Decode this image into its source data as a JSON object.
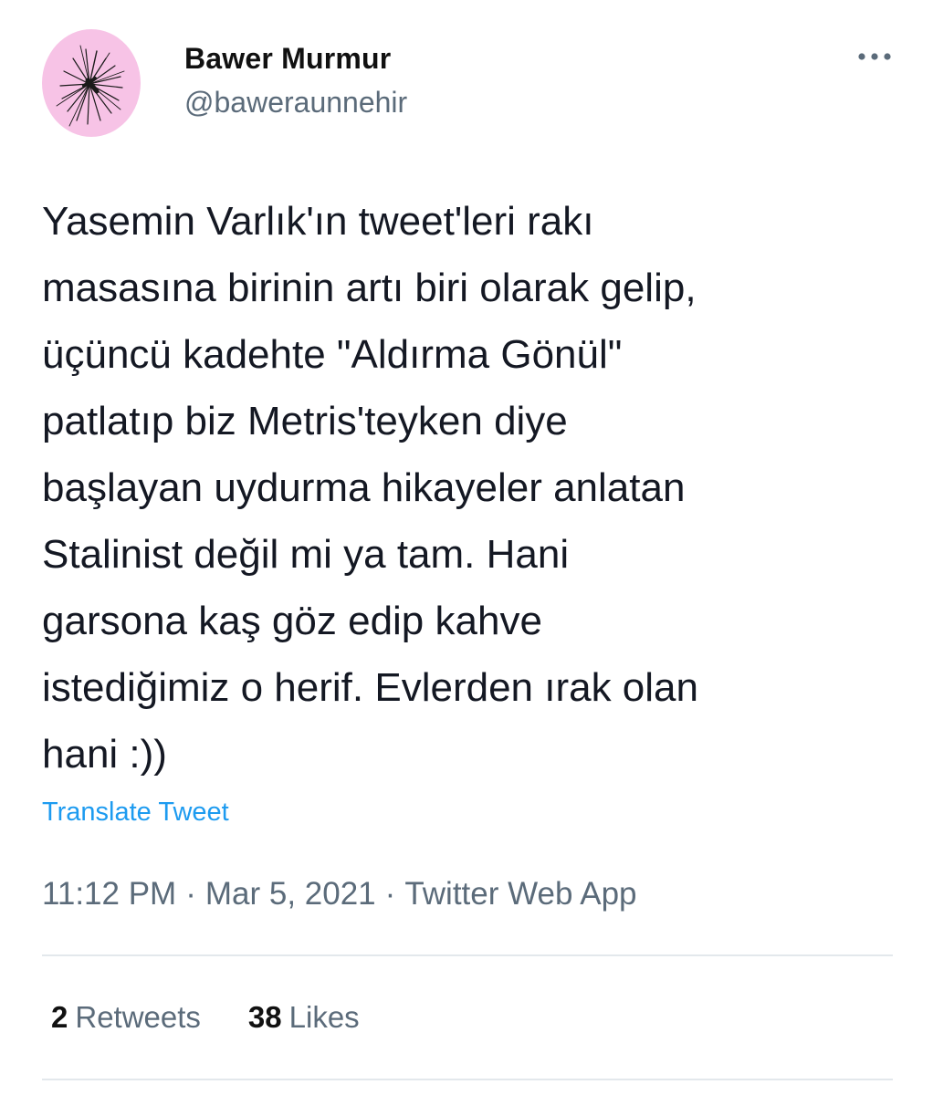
{
  "author": {
    "name": "Bawer Murmur",
    "handle": "@baweraunnehir",
    "avatar_icon": "spiky-dandelion-avatar",
    "avatar_bg": "#f7c3e6"
  },
  "menu": {
    "icon": "more-dots-icon"
  },
  "tweet": {
    "text": "Yasemin Varlık'ın tweet'leri rakı\nmasasına birinin artı biri olarak gelip,\nüçüncü kadehte \"Aldırma Gönül\"\npatlatıp biz Metris'teyken diye\nbaşlayan uydurma hikayeler anlatan\nStalinist değil mi ya tam. Hani\ngarsona kaş göz edip kahve\nistediğimiz o herif. Evlerden ırak olan\nhani :))",
    "translate_label": "Translate Tweet"
  },
  "meta": {
    "time": "11:12 PM",
    "separator": "·",
    "date": "Mar 5, 2021",
    "source": "Twitter Web App"
  },
  "stats": {
    "retweets_count": "2",
    "retweets_label": "Retweets",
    "likes_count": "38",
    "likes_label": "Likes"
  },
  "colors": {
    "link": "#1d9bf0",
    "secondary": "#5b6b7a",
    "divider": "#e3e8ec"
  }
}
